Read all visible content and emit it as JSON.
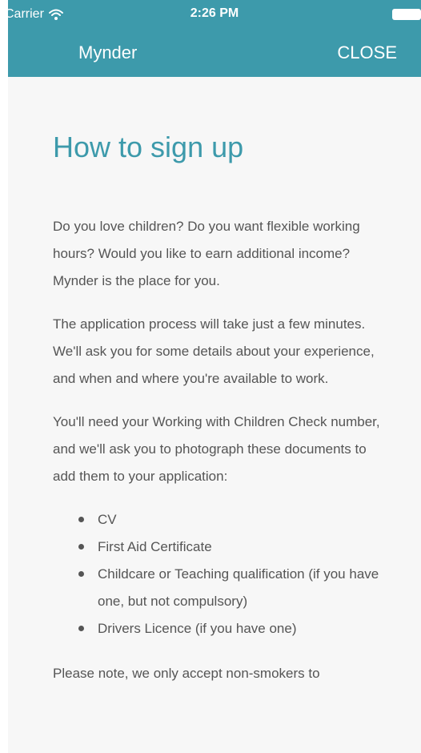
{
  "status_bar": {
    "carrier": "Carrier",
    "time": "2:26 PM"
  },
  "nav": {
    "title": "Mynder",
    "close_label": "CLOSE"
  },
  "content": {
    "title": "How to sign up",
    "paragraphs": [
      "Do you love children? Do you want flexible working hours? Would you like to earn additional income? Mynder is the place for you.",
      "The application process will take just a few minutes. We'll ask you for some details about your experience, and when and where you're available to work.",
      "You'll need your Working with Children Check number, and we'll ask you to photograph these documents to add them to your application:"
    ],
    "documents": [
      "CV",
      "First Aid Certificate",
      "Childcare or Teaching qualification (if you have one, but not compulsory)",
      "Drivers Licence (if you have one)"
    ],
    "note": "Please note, we only accept non-smokers to"
  },
  "colors": {
    "accent": "#3d9aab",
    "background": "#f7f7f7",
    "text": "#555555"
  },
  "icons": {
    "wifi": "wifi-icon",
    "battery": "battery-icon"
  }
}
